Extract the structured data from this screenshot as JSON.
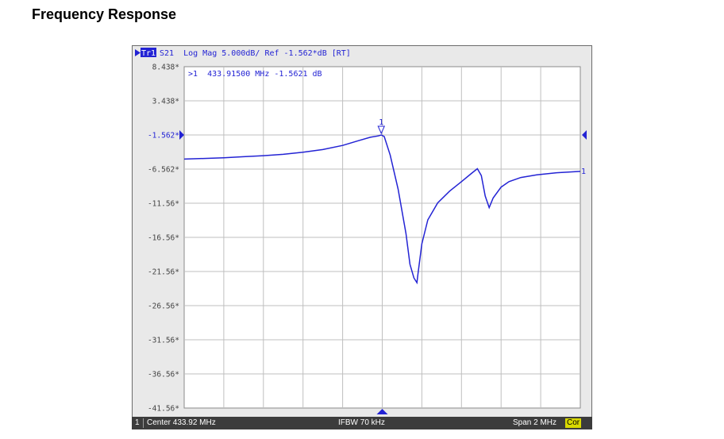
{
  "page_title": "Frequency Response",
  "trace_header": {
    "trace_tag": "Tr1",
    "text": "S21  Log Mag 5.000dB/ Ref -1.562*dB [RT]"
  },
  "marker_readout": {
    "text": ">1  433.91500 MHz -1.5621 dB"
  },
  "status_bar": {
    "channel": "1",
    "center": "Center 433.92 MHz",
    "ifbw": "IFBW 70 kHz",
    "span": "Span 2 MHz",
    "cor": "Cor"
  },
  "colors": {
    "trace": "#2323d4",
    "grid": "#bfbfbf",
    "marker": "#2323d4",
    "frame": "#e9e9e9",
    "plot_bg": "#ffffff",
    "status_bg": "#3c3c3c"
  },
  "chart_data": {
    "type": "line",
    "x_unit": "MHz",
    "xlim": [
      432.92,
      434.92
    ],
    "ylim": [
      -41.562,
      8.438
    ],
    "y_tick_labels": [
      "8.438*",
      "3.438*",
      "-1.562*",
      "-6.562*",
      "-11.56*",
      "-16.56*",
      "-21.56*",
      "-26.56*",
      "-31.56*",
      "-36.56*",
      "-41.56*"
    ],
    "y_ticks": [
      8.438,
      3.438,
      -1.562,
      -6.562,
      -11.562,
      -16.562,
      -21.562,
      -26.562,
      -31.562,
      -36.562,
      -41.562
    ],
    "x_divisions": 10,
    "grid": true,
    "reference_level": -1.562,
    "series": [
      {
        "x": [
          432.92,
          433.02,
          433.12,
          433.22,
          433.32,
          433.42,
          433.52,
          433.62,
          433.72,
          433.8,
          433.86,
          433.9,
          433.915,
          433.93,
          433.96,
          434.0,
          434.04,
          434.06,
          434.08,
          434.095,
          434.1,
          434.12,
          434.15,
          434.2,
          434.26,
          434.32,
          434.37,
          434.4,
          434.42,
          434.44,
          434.46,
          434.48,
          434.52,
          434.56,
          434.62,
          434.7,
          434.8,
          434.92
        ],
        "y": [
          -5.1,
          -5.0,
          -4.9,
          -4.75,
          -4.6,
          -4.4,
          -4.1,
          -3.7,
          -3.1,
          -2.4,
          -1.9,
          -1.7,
          -1.562,
          -1.8,
          -4.5,
          -9.5,
          -16.0,
          -20.5,
          -22.5,
          -23.2,
          -22.0,
          -17.5,
          -14.0,
          -11.5,
          -9.8,
          -8.4,
          -7.2,
          -6.5,
          -7.5,
          -10.5,
          -12.2,
          -10.8,
          -9.2,
          -8.4,
          -7.8,
          -7.4,
          -7.1,
          -6.9
        ]
      }
    ],
    "marker": {
      "label": "1",
      "x": 433.915,
      "y": -1.5621
    },
    "trace_end_label": "1"
  }
}
